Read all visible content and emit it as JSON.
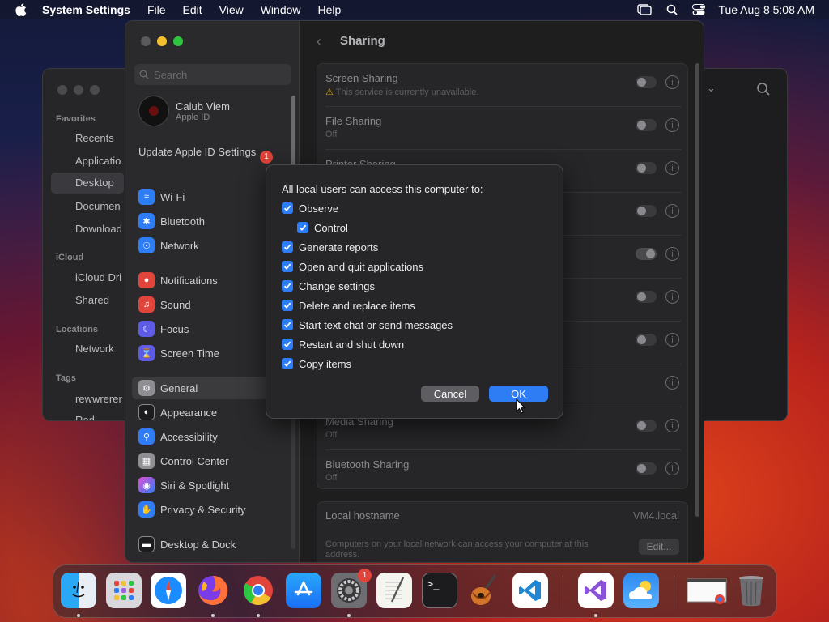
{
  "menubar": {
    "app": "System Settings",
    "menus": [
      "File",
      "Edit",
      "View",
      "Window",
      "Help"
    ],
    "clock": "Tue Aug 8  5:08 AM"
  },
  "finder": {
    "sections": {
      "favorites": "Favorites",
      "icloud": "iCloud",
      "locations": "Locations",
      "tags": "Tags"
    },
    "items": {
      "recents": "Recents",
      "applications": "Applicatio",
      "desktop": "Desktop",
      "documents": "Documen",
      "downloads": "Download",
      "icloud_drive": "iCloud Dri",
      "shared": "Shared",
      "network": "Network",
      "tag1": "rewwrerer",
      "tag2": "Red"
    }
  },
  "settings": {
    "search_placeholder": "Search",
    "profile": {
      "name": "Calub Viem",
      "sub": "Apple ID"
    },
    "update": {
      "label": "Update Apple ID Settings",
      "badge": "1"
    },
    "nav": {
      "wifi": "Wi-Fi",
      "bluetooth": "Bluetooth",
      "network": "Network",
      "notifications": "Notifications",
      "sound": "Sound",
      "focus": "Focus",
      "screen_time": "Screen Time",
      "general": "General",
      "appearance": "Appearance",
      "accessibility": "Accessibility",
      "control_center": "Control Center",
      "siri": "Siri & Spotlight",
      "privacy": "Privacy & Security",
      "desktop_dock": "Desktop & Dock"
    },
    "title": "Sharing",
    "rows": {
      "screen_sharing": {
        "title": "Screen Sharing",
        "sub": "This service is currently unavailable."
      },
      "file_sharing": {
        "title": "File Sharing",
        "sub": "Off"
      },
      "printer_sharing": {
        "title": "Printer Sharing"
      },
      "media_sharing": {
        "title": "Media Sharing",
        "sub": "Off"
      },
      "bluetooth_sharing": {
        "title": "Bluetooth Sharing",
        "sub": "Off"
      }
    },
    "hostname": {
      "label": "Local hostname",
      "value": "VM4.local",
      "desc": "Computers on your local network can access your computer at this address.",
      "edit": "Edit..."
    }
  },
  "dialog": {
    "header": "All local users can access this computer to:",
    "options": {
      "observe": "Observe",
      "control": "Control",
      "generate_reports": "Generate reports",
      "open_quit": "Open and quit applications",
      "change_settings": "Change settings",
      "delete_replace": "Delete and replace items",
      "text_chat": "Start text chat or send messages",
      "restart_shutdown": "Restart and shut down",
      "copy_items": "Copy items"
    },
    "cancel": "Cancel",
    "ok": "OK"
  },
  "dock": {
    "badge_settings": "1",
    "apps": [
      "finder-icon",
      "launchpad-icon",
      "safari-icon",
      "firefox-icon",
      "chrome-icon",
      "app-store-icon",
      "system-settings-icon",
      "textedit-icon",
      "terminal-icon",
      "garageband-icon",
      "vscode-icon",
      "visual-studio-icon",
      "weather-icon",
      "chrome-window-icon",
      "trash-icon"
    ],
    "colors": {
      "finder": "#1e88e5",
      "safari": "#1565c0",
      "firefox": "#ff7139",
      "chrome": "#4caf50",
      "appstore": "#1a8cff",
      "vscode": "#1e88d5"
    }
  }
}
